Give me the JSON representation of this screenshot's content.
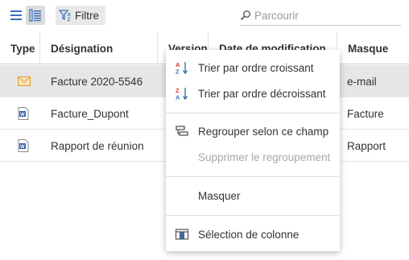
{
  "toolbar": {
    "view_list_icon": "list-view-icon",
    "view_detail_icon": "detail-view-icon",
    "filter_label": "Filtre",
    "search_placeholder": "Parcourir",
    "search_value": ""
  },
  "table": {
    "columns": [
      "Type",
      "Désignation",
      "Version",
      "Date de modification",
      "Masque"
    ],
    "rows": [
      {
        "type_icon": "email-icon",
        "designation": "Facture 2020-5546",
        "masque": "e-mail",
        "selected": true
      },
      {
        "type_icon": "word-document-icon",
        "designation": "Facture_Dupont",
        "masque": "Facture",
        "selected": false
      },
      {
        "type_icon": "word-document-icon",
        "designation": "Rapport de réunion",
        "masque": "Rapport",
        "selected": false
      }
    ]
  },
  "context_menu": {
    "sort_asc": "Trier par ordre croissant",
    "sort_desc": "Trier par ordre décroissant",
    "group": "Regrouper selon ce champ",
    "ungroup": "Supprimer le regroupement",
    "hide": "Masquer",
    "column_select": "Sélection de colonne"
  },
  "colors": {
    "accent_blue": "#3a6fb5",
    "sort_red": "#d8332a",
    "selected_row": "#e6e6e6",
    "email_icon": "#e0a035"
  }
}
